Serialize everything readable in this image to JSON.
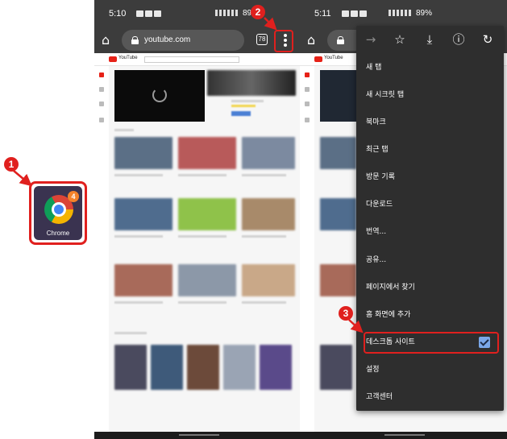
{
  "steps": [
    "1",
    "2",
    "3"
  ],
  "app": {
    "label": "Chrome",
    "badge": "4"
  },
  "left_phone": {
    "status": {
      "time": "5:10",
      "battery": "89%"
    },
    "toolbar": {
      "url": "youtube.com",
      "tab_count": "78"
    },
    "page": {
      "logo_text": "YouTube"
    }
  },
  "right_phone": {
    "status": {
      "time": "5:11",
      "battery": "89%"
    },
    "page": {
      "logo_text": "YouTube"
    }
  },
  "menu": {
    "items": [
      {
        "label": "새 탭"
      },
      {
        "label": "새 시크릿 탭"
      },
      {
        "label": "북마크"
      },
      {
        "label": "최근 탭"
      },
      {
        "label": "방문 기록"
      },
      {
        "label": "다운로드"
      },
      {
        "label": "번역..."
      },
      {
        "label": "공유..."
      },
      {
        "label": "페이지에서 찾기"
      },
      {
        "label": "홈 화면에 추가"
      },
      {
        "label": "데스크톱 사이트",
        "checked": true
      },
      {
        "label": "설정"
      },
      {
        "label": "고객센터"
      }
    ]
  },
  "colors": {
    "highlight": "#e0201e",
    "chrome_bar": "#3c3c3c",
    "menu_bg": "#2e2e2e",
    "checkbox": "#7aa7e8"
  }
}
